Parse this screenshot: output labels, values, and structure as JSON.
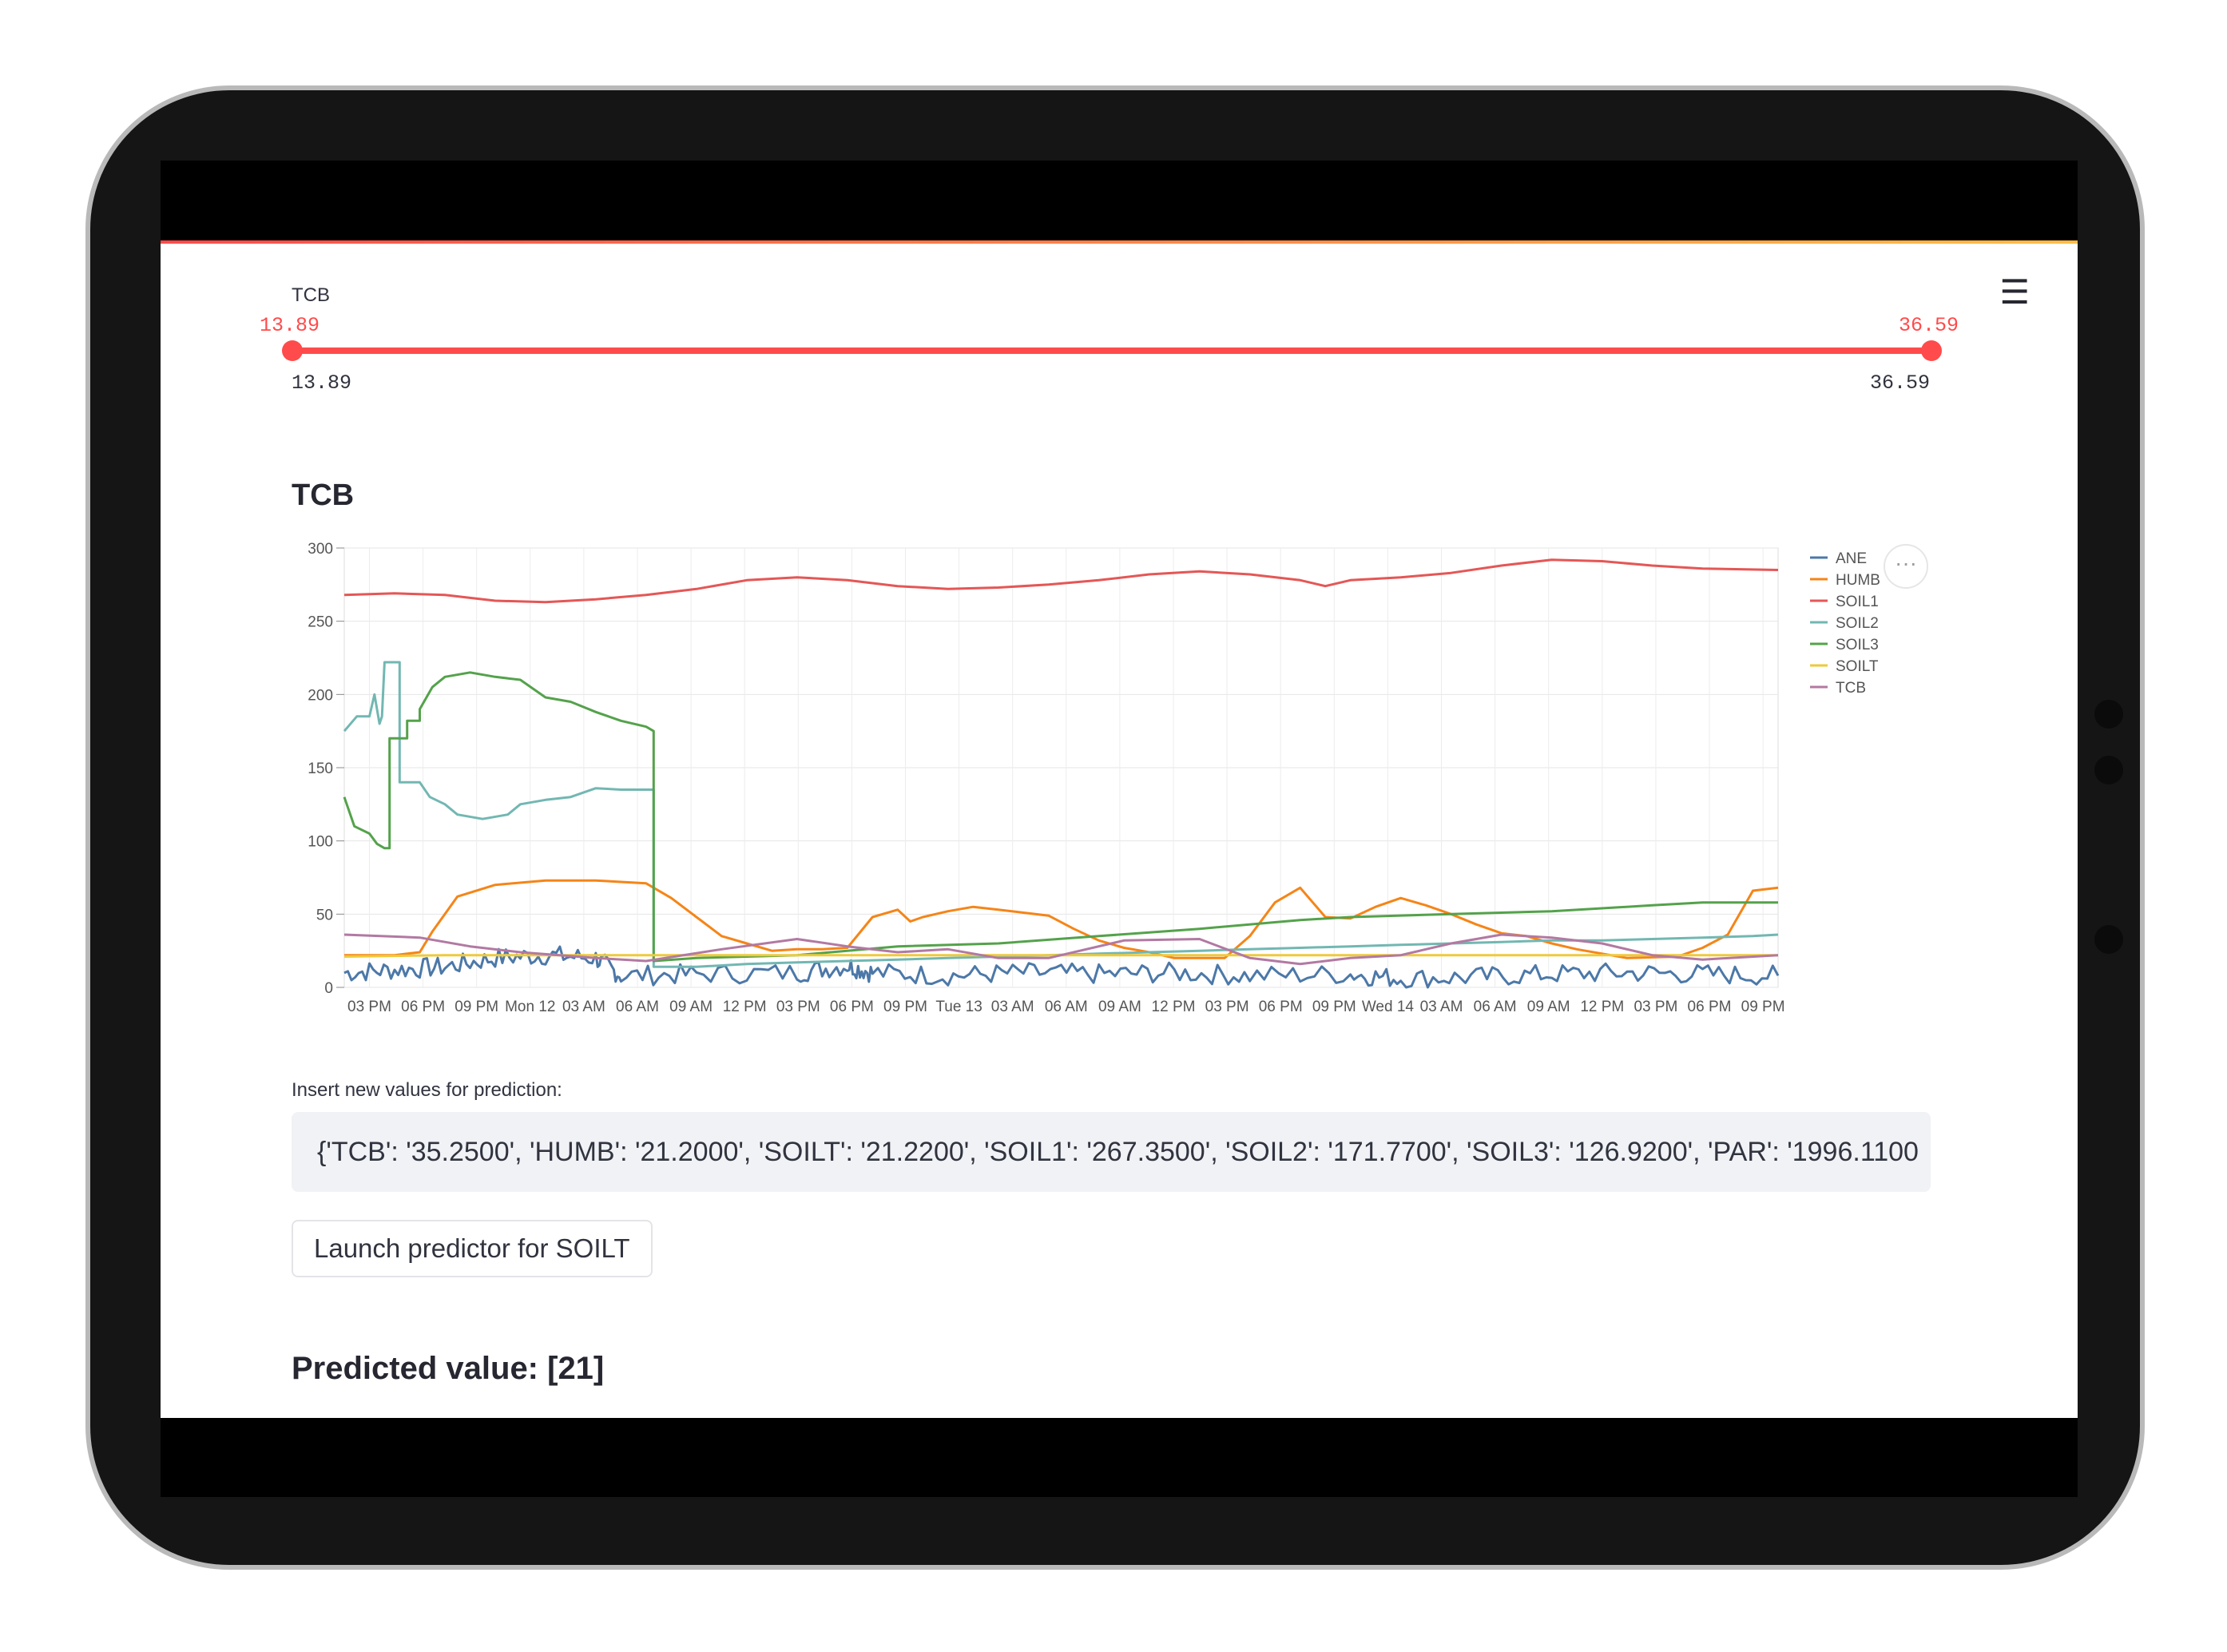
{
  "slider": {
    "label": "TCB",
    "low_value": "13.89",
    "high_value": "36.59",
    "min_label": "13.89",
    "max_label": "36.59",
    "selected_low_fraction": 0,
    "selected_high_fraction": 1
  },
  "menu_icon": "hamburger-icon",
  "chart_title": "TCB",
  "chart_menu_icon": "ellipsis-icon",
  "chart_data": {
    "type": "line",
    "ylim": [
      0,
      300
    ],
    "yticks": [
      0,
      50,
      100,
      150,
      200,
      250,
      300
    ],
    "xticks": [
      "03 PM",
      "06 PM",
      "09 PM",
      "Mon 12",
      "03 AM",
      "06 AM",
      "09 AM",
      "12 PM",
      "03 PM",
      "06 PM",
      "09 PM",
      "Tue 13",
      "03 AM",
      "06 AM",
      "09 AM",
      "12 PM",
      "03 PM",
      "06 PM",
      "09 PM",
      "Wed 14",
      "03 AM",
      "06 AM",
      "09 AM",
      "12 PM",
      "03 PM",
      "06 PM",
      "09 PM"
    ],
    "xrange_hours": [
      0,
      57
    ],
    "grid": true,
    "legend_position": "right",
    "series": [
      {
        "name": "ANE",
        "color": "#4c78a8",
        "points": [
          [
            0,
            10
          ],
          [
            2,
            12
          ],
          [
            4,
            14
          ],
          [
            6,
            20
          ],
          [
            8,
            22
          ],
          [
            10,
            20
          ],
          [
            11,
            8
          ],
          [
            14,
            9
          ],
          [
            18,
            10
          ],
          [
            20,
            15
          ],
          [
            21,
            10
          ],
          [
            24,
            8
          ],
          [
            27,
            10
          ],
          [
            30,
            9
          ],
          [
            33,
            10
          ],
          [
            36,
            8
          ],
          [
            40,
            9
          ],
          [
            42,
            6
          ],
          [
            45,
            7
          ],
          [
            48,
            9
          ],
          [
            51,
            10
          ],
          [
            54,
            9
          ],
          [
            57,
            8
          ]
        ],
        "noise": 7
      },
      {
        "name": "HUMB",
        "color": "#f58518",
        "points": [
          [
            0,
            22
          ],
          [
            2,
            22
          ],
          [
            3,
            24
          ],
          [
            3.5,
            38
          ],
          [
            4.5,
            62
          ],
          [
            6,
            70
          ],
          [
            8,
            73
          ],
          [
            10,
            73
          ],
          [
            11,
            72
          ],
          [
            12,
            71
          ],
          [
            13,
            61
          ],
          [
            14,
            48
          ],
          [
            15,
            35
          ],
          [
            16,
            30
          ],
          [
            17,
            25
          ],
          [
            18,
            26
          ],
          [
            19,
            26
          ],
          [
            20,
            27
          ],
          [
            21,
            48
          ],
          [
            22,
            53
          ],
          [
            22.5,
            45
          ],
          [
            23,
            48
          ],
          [
            24,
            52
          ],
          [
            25,
            55
          ],
          [
            26,
            53
          ],
          [
            27,
            51
          ],
          [
            28,
            49
          ],
          [
            29,
            40
          ],
          [
            30,
            32
          ],
          [
            31,
            27
          ],
          [
            32,
            24
          ],
          [
            33,
            20
          ],
          [
            35,
            20
          ],
          [
            36,
            35
          ],
          [
            37,
            58
          ],
          [
            38,
            68
          ],
          [
            39,
            48
          ],
          [
            40,
            47
          ],
          [
            41,
            55
          ],
          [
            42,
            61
          ],
          [
            43,
            56
          ],
          [
            44,
            50
          ],
          [
            45,
            43
          ],
          [
            46,
            37
          ],
          [
            47,
            35
          ],
          [
            48,
            30
          ],
          [
            49,
            26
          ],
          [
            50,
            23
          ],
          [
            51,
            20
          ],
          [
            53,
            21
          ],
          [
            54,
            27
          ],
          [
            55,
            36
          ],
          [
            56,
            66
          ],
          [
            57,
            68
          ]
        ]
      },
      {
        "name": "SOIL1",
        "color": "#e45756",
        "points": [
          [
            0,
            268
          ],
          [
            2,
            269
          ],
          [
            4,
            268
          ],
          [
            6,
            264
          ],
          [
            8,
            263
          ],
          [
            10,
            265
          ],
          [
            12,
            268
          ],
          [
            14,
            272
          ],
          [
            16,
            278
          ],
          [
            18,
            280
          ],
          [
            20,
            278
          ],
          [
            22,
            274
          ],
          [
            24,
            272
          ],
          [
            26,
            273
          ],
          [
            28,
            275
          ],
          [
            30,
            278
          ],
          [
            32,
            282
          ],
          [
            34,
            284
          ],
          [
            36,
            282
          ],
          [
            38,
            278
          ],
          [
            39,
            274
          ],
          [
            40,
            278
          ],
          [
            42,
            280
          ],
          [
            44,
            283
          ],
          [
            46,
            288
          ],
          [
            48,
            292
          ],
          [
            50,
            291
          ],
          [
            52,
            288
          ],
          [
            54,
            286
          ],
          [
            57,
            285
          ]
        ]
      },
      {
        "name": "SOIL2",
        "color": "#72b7b2",
        "points": [
          [
            0,
            175
          ],
          [
            0.5,
            185
          ],
          [
            1,
            185
          ],
          [
            1.2,
            200
          ],
          [
            1.4,
            180
          ],
          [
            1.5,
            185
          ],
          [
            1.6,
            222
          ],
          [
            2.2,
            222
          ],
          [
            2.2,
            140
          ],
          [
            3,
            140
          ],
          [
            3.4,
            130
          ],
          [
            4,
            125
          ],
          [
            4.5,
            118
          ],
          [
            5.5,
            115
          ],
          [
            6.5,
            118
          ],
          [
            7,
            125
          ],
          [
            8,
            128
          ],
          [
            9,
            130
          ],
          [
            10,
            136
          ],
          [
            11,
            135
          ],
          [
            12,
            135
          ],
          [
            12.3,
            135
          ],
          [
            12.3,
            14
          ],
          [
            14,
            14
          ],
          [
            16,
            16
          ],
          [
            18,
            17
          ],
          [
            20,
            18
          ],
          [
            22,
            19
          ],
          [
            24,
            20
          ],
          [
            26,
            21
          ],
          [
            28,
            22
          ],
          [
            30,
            23
          ],
          [
            32,
            24
          ],
          [
            34,
            25
          ],
          [
            36,
            26
          ],
          [
            38,
            27
          ],
          [
            40,
            28
          ],
          [
            42,
            29
          ],
          [
            44,
            30
          ],
          [
            46,
            31
          ],
          [
            48,
            32
          ],
          [
            50,
            32
          ],
          [
            52,
            33
          ],
          [
            54,
            34
          ],
          [
            56,
            35
          ],
          [
            57,
            36
          ]
        ]
      },
      {
        "name": "SOIL3",
        "color": "#54a24b",
        "points": [
          [
            0,
            130
          ],
          [
            0.4,
            110
          ],
          [
            1,
            105
          ],
          [
            1.3,
            98
          ],
          [
            1.6,
            95
          ],
          [
            1.8,
            95
          ],
          [
            1.8,
            170
          ],
          [
            2.5,
            170
          ],
          [
            2.5,
            182
          ],
          [
            3,
            182
          ],
          [
            3,
            190
          ],
          [
            3.5,
            205
          ],
          [
            4,
            212
          ],
          [
            5,
            215
          ],
          [
            6,
            212
          ],
          [
            7,
            210
          ],
          [
            8,
            198
          ],
          [
            9,
            195
          ],
          [
            10,
            188
          ],
          [
            11,
            182
          ],
          [
            12,
            178
          ],
          [
            12.3,
            175
          ],
          [
            12.3,
            18
          ],
          [
            14,
            20
          ],
          [
            18,
            22
          ],
          [
            22,
            28
          ],
          [
            26,
            30
          ],
          [
            30,
            35
          ],
          [
            34,
            40
          ],
          [
            38,
            46
          ],
          [
            40,
            48
          ],
          [
            44,
            50
          ],
          [
            48,
            52
          ],
          [
            52,
            56
          ],
          [
            54,
            58
          ],
          [
            57,
            58
          ]
        ]
      },
      {
        "name": "SOILT",
        "color": "#eeca3b",
        "points": [
          [
            0,
            21
          ],
          [
            4,
            22
          ],
          [
            8,
            22
          ],
          [
            12,
            22
          ],
          [
            16,
            22
          ],
          [
            20,
            22
          ],
          [
            24,
            22
          ],
          [
            28,
            22
          ],
          [
            32,
            22
          ],
          [
            36,
            22
          ],
          [
            40,
            22
          ],
          [
            44,
            22
          ],
          [
            48,
            22
          ],
          [
            52,
            22
          ],
          [
            57,
            22
          ]
        ]
      },
      {
        "name": "TCB",
        "color": "#b279a2",
        "points": [
          [
            0,
            36
          ],
          [
            3,
            34
          ],
          [
            5,
            28
          ],
          [
            7,
            24
          ],
          [
            10,
            20
          ],
          [
            12,
            18
          ],
          [
            15,
            26
          ],
          [
            18,
            33
          ],
          [
            20,
            28
          ],
          [
            22,
            24
          ],
          [
            24,
            26
          ],
          [
            26,
            20
          ],
          [
            28,
            20
          ],
          [
            31,
            32
          ],
          [
            34,
            33
          ],
          [
            36,
            20
          ],
          [
            38,
            16
          ],
          [
            40,
            20
          ],
          [
            42,
            22
          ],
          [
            44,
            30
          ],
          [
            46,
            36
          ],
          [
            48,
            34
          ],
          [
            50,
            30
          ],
          [
            52,
            22
          ],
          [
            54,
            19
          ],
          [
            57,
            22
          ]
        ]
      }
    ]
  },
  "input": {
    "label": "Insert new values for prediction:",
    "value": "{'TCB': '35.2500', 'HUMB': '21.2000', 'SOILT': '21.2200', 'SOIL1': '267.3500', 'SOIL2': '171.7700', 'SOIL3': '126.9200', 'PAR': '1996.1100"
  },
  "predict_button": {
    "label": "Launch predictor for SOILT"
  },
  "prediction": {
    "text": "Predicted value: [21]"
  }
}
